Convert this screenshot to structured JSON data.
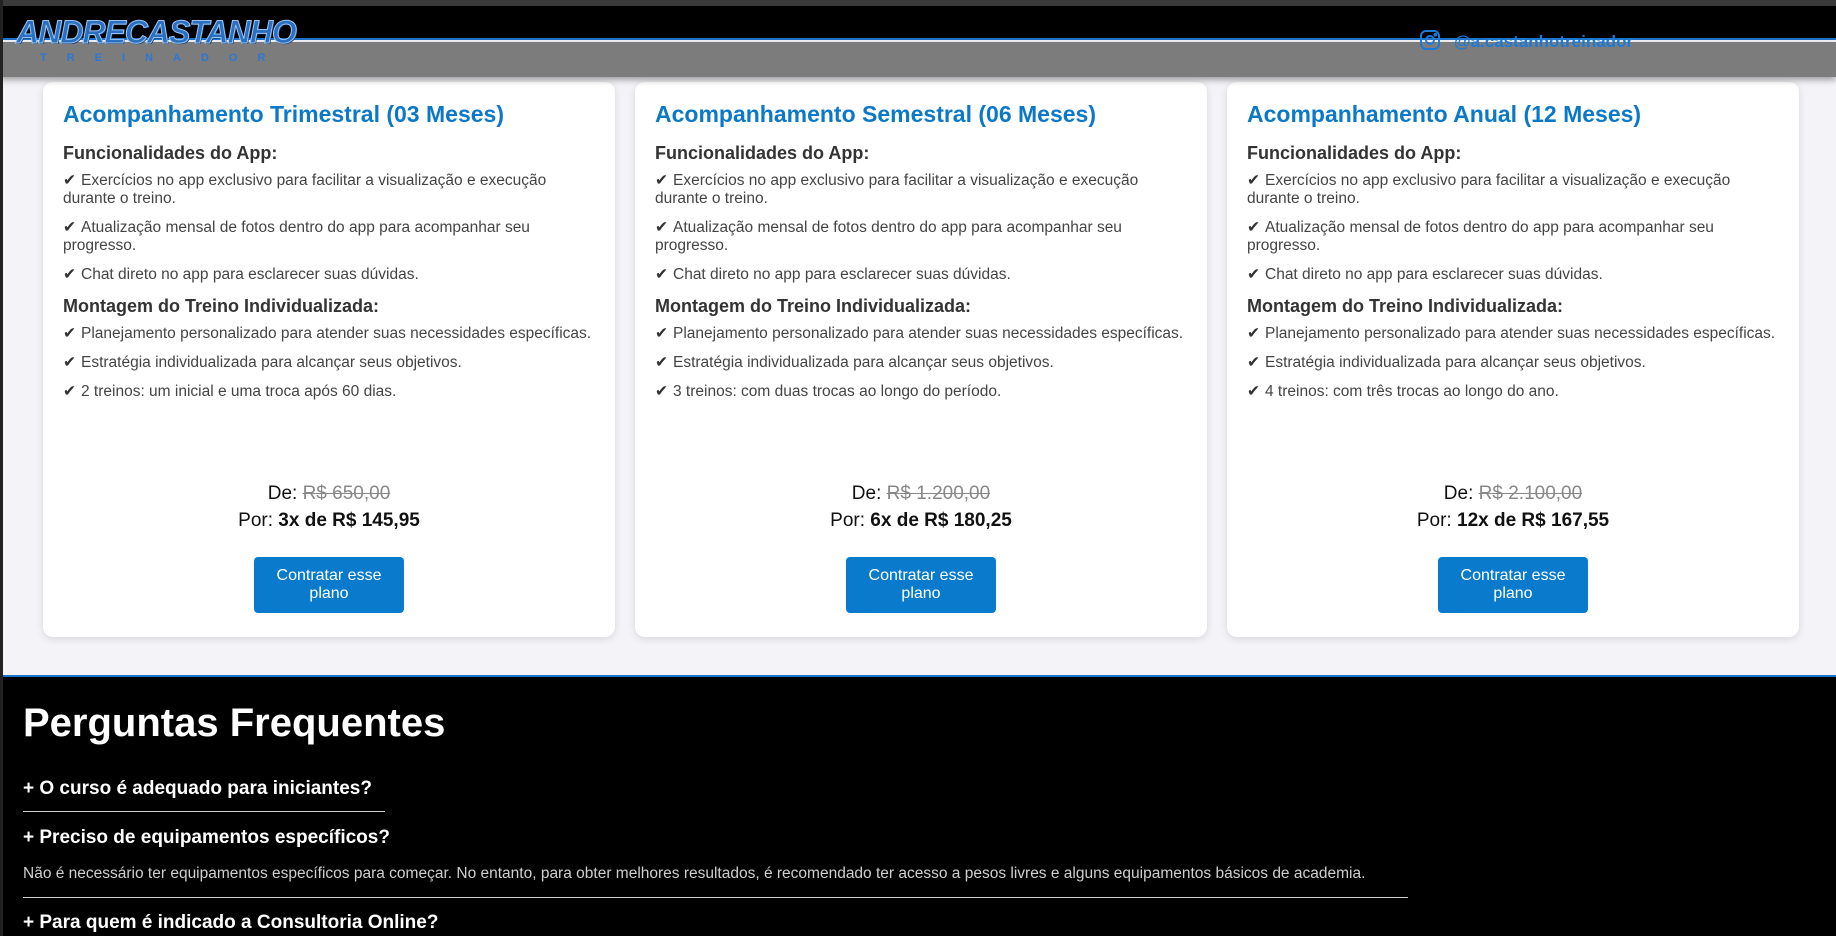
{
  "header": {
    "logo_main": "ANDRECASTANHO",
    "logo_sub": "TREINADOR",
    "instagram_handle": "@a.castanhotreinador",
    "accent_color": "#1d72c9"
  },
  "plans": [
    {
      "title": "Acompanhamento Trimestral (03 Meses)",
      "section1_title": "Funcionalidades do App:",
      "section1_items": [
        "Exercícios no app exclusivo para facilitar a visualização e execução durante o treino.",
        "Atualização mensal de fotos dentro do app para acompanhar seu progresso.",
        "Chat direto no app para esclarecer suas dúvidas."
      ],
      "section2_title": "Montagem do Treino Individualizada:",
      "section2_items": [
        "Planejamento personalizado para atender suas necessidades específicas.",
        "Estratégia individualizada para alcançar seus objetivos.",
        "2 treinos: um inicial e uma troca após 60 dias."
      ],
      "de_label": "De:",
      "old_price": "R$ 650,00",
      "por_label": "Por:",
      "new_price": "3x de R$ 145,95",
      "button": "Contratar esse plano"
    },
    {
      "title": "Acompanhamento Semestral (06 Meses)",
      "section1_title": "Funcionalidades do App:",
      "section1_items": [
        "Exercícios no app exclusivo para facilitar a visualização e execução durante o treino.",
        "Atualização mensal de fotos dentro do app para acompanhar seu progresso.",
        "Chat direto no app para esclarecer suas dúvidas."
      ],
      "section2_title": "Montagem do Treino Individualizada:",
      "section2_items": [
        "Planejamento personalizado para atender suas necessidades específicas.",
        "Estratégia individualizada para alcançar seus objetivos.",
        "3 treinos: com duas trocas ao longo do período."
      ],
      "de_label": "De:",
      "old_price": "R$ 1.200,00",
      "por_label": "Por:",
      "new_price": "6x de R$ 180,25",
      "button": "Contratar esse plano"
    },
    {
      "title": "Acompanhamento Anual (12 Meses)",
      "section1_title": "Funcionalidades do App:",
      "section1_items": [
        "Exercícios no app exclusivo para facilitar a visualização e execução durante o treino.",
        "Atualização mensal de fotos dentro do app para acompanhar seu progresso.",
        "Chat direto no app para esclarecer suas dúvidas."
      ],
      "section2_title": "Montagem do Treino Individualizada:",
      "section2_items": [
        "Planejamento personalizado para atender suas necessidades específicas.",
        "Estratégia individualizada para alcançar seus objetivos.",
        "4 treinos: com três trocas ao longo do ano."
      ],
      "de_label": "De:",
      "old_price": "R$ 2.100,00",
      "por_label": "Por:",
      "new_price": "12x de R$ 167,55",
      "button": "Contratar esse plano"
    }
  ],
  "faq": {
    "title": "Perguntas Frequentes",
    "items": [
      {
        "question": "+ O curso é adequado para iniciantes?",
        "answer": ""
      },
      {
        "question": "+ Preciso de equipamentos específicos?",
        "answer": "Não é necessário ter equipamentos específicos para começar. No entanto, para obter melhores resultados, é recomendado ter acesso a pesos livres e alguns equipamentos básicos de academia."
      },
      {
        "question": "+ Para quem é indicado a Consultoria Online?",
        "answer": ""
      }
    ]
  }
}
